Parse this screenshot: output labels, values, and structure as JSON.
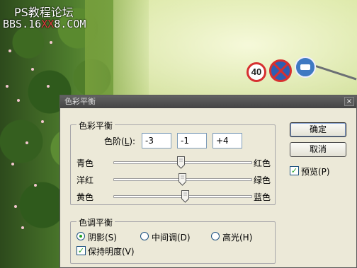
{
  "watermark": {
    "line1": "PS教程论坛",
    "line2_a": "BBS.16",
    "line2_b": "XX",
    "line2_c": "8.COM"
  },
  "background": {
    "speed_sign": "40"
  },
  "dialog": {
    "title": "色彩平衡",
    "close_glyph": "×",
    "color_balance_group": {
      "title": "色彩平衡",
      "levels_label": "色阶(L):",
      "levels_label_key": "L",
      "values": [
        "-3",
        "-1",
        "+4"
      ],
      "sliders": [
        {
          "left": "青色",
          "right": "红色",
          "value": -3
        },
        {
          "left": "洋红",
          "right": "绿色",
          "value": -1
        },
        {
          "left": "黄色",
          "right": "蓝色",
          "value": 4
        }
      ],
      "slider_range": [
        -100,
        100
      ]
    },
    "tone_balance_group": {
      "title": "色调平衡",
      "options": [
        {
          "label": "阴影(S)",
          "selected": true
        },
        {
          "label": "中间调(D)",
          "selected": false
        },
        {
          "label": "高光(H)",
          "selected": false
        }
      ],
      "preserve_luminosity": {
        "label": "保持明度(V)",
        "checked": true
      }
    },
    "buttons": {
      "ok": "确定",
      "cancel": "取消"
    },
    "preview": {
      "label": "预览(P)",
      "checked": true
    }
  }
}
